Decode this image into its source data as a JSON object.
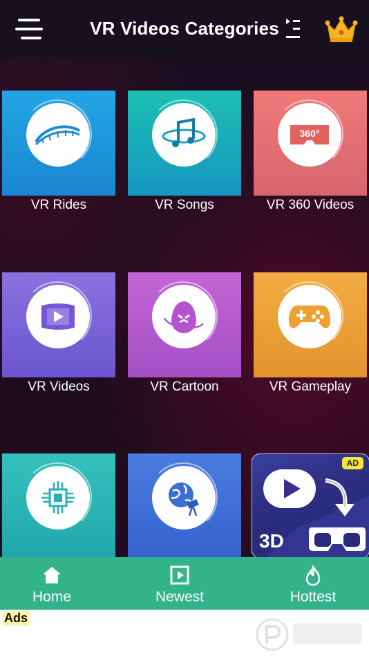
{
  "header": {
    "title": "VR Videos Categories",
    "menu_icon": "hamburger-menu-icon",
    "queue_icon": "playlist-icon",
    "premium_icon": "crown-icon"
  },
  "categories": [
    {
      "label": "VR Rides",
      "icon": "roller-coaster-icon",
      "color": "#1f96dc"
    },
    {
      "label": "VR Songs",
      "icon": "music-note-icon",
      "color": "#1aa8b8"
    },
    {
      "label": "VR 360 Videos",
      "icon": "vr-360-icon",
      "color": "#e06f6f"
    },
    {
      "label": "VR Videos",
      "icon": "video-screen-icon",
      "color": "#7a61d8"
    },
    {
      "label": "VR Cartoon",
      "icon": "cartoon-egg-icon",
      "color": "#b858c8"
    },
    {
      "label": "VR Gameplay",
      "icon": "gamepad-icon",
      "color": "#f0a43a"
    },
    {
      "label": "",
      "icon": "chip-icon",
      "color": "#2fb5b3"
    },
    {
      "label": "",
      "icon": "planet-telescope-icon",
      "color": "#3b6fd6"
    }
  ],
  "ad_tile": {
    "badge": "AD",
    "text": "3D",
    "icons": [
      "play-icon",
      "vr-headset-icon"
    ]
  },
  "bottom_nav": [
    {
      "label": "Home",
      "icon": "home-icon"
    },
    {
      "label": "Newest",
      "icon": "play-square-icon"
    },
    {
      "label": "Hottest",
      "icon": "flame-icon"
    }
  ],
  "ads": {
    "label": "Ads"
  },
  "colors": {
    "nav_bg": "#33b38a",
    "header_bg": "#16101f"
  }
}
